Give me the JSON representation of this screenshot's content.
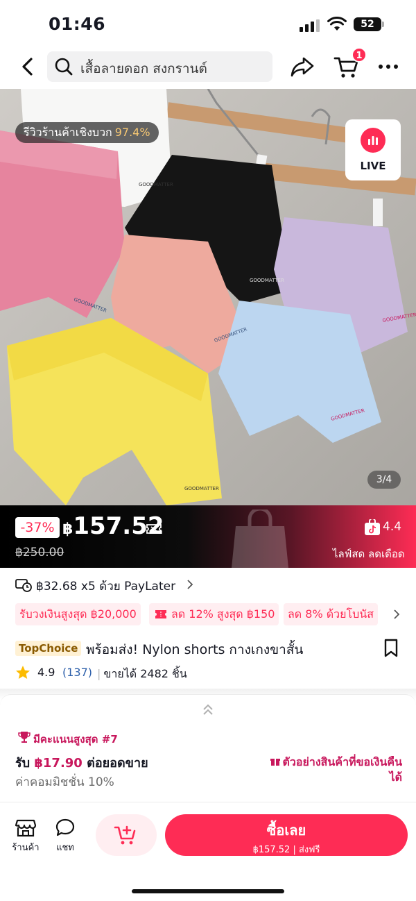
{
  "status_bar": {
    "time": "01:46",
    "battery": "52"
  },
  "search": {
    "query": "เสื้อลายดอก สงกรานต์"
  },
  "cart": {
    "badge": "1"
  },
  "gallery": {
    "review_label": "รีวิวร้านค้าเชิงบวก",
    "review_pct": "97.4%",
    "live_label": "LIVE",
    "page_indicator": "3/4",
    "garment_brand": "GOODMATTER"
  },
  "price": {
    "discount": "-37%",
    "currency": "฿",
    "current": "157.52",
    "original": "฿250.00",
    "tt_rating": "4.4",
    "live_sale": "ไลฟ์สด ลดเดือด"
  },
  "paylater": {
    "text": "฿32.68 x5 ด้วย PayLater"
  },
  "promos": [
    "รับวงเงินสูงสุด ฿20,000",
    "ลด 12% สูงสุด ฿150",
    "ลด 8% ด้วยโบนัส"
  ],
  "product": {
    "badge": "TopChoice",
    "title": "พร้อมส่ง! Nylon shorts กางเกงขาสั้น",
    "rating": "4.9",
    "reviews": "(137)",
    "sold": "ขายได้ 2482 ชิ้น"
  },
  "affiliate": {
    "rank": "มีคะแนนสูงสุด #7",
    "earn_prefix": "รับ",
    "earn_amount": "฿17.90",
    "earn_suffix": "ต่อยอดขาย",
    "commission": "ค่าคอมมิชชั่น 10%",
    "refund_link": "ตัวอย่างสินค้าที่ขอเงินคืนได้"
  },
  "bottom_bar": {
    "shop_label": "ร้านค้า",
    "chat_label": "แชท",
    "buy_label": "ซื้อเลย",
    "buy_sub": "฿157.52 | ส่งฟรี"
  },
  "colors": {
    "accent": "#fe2c55",
    "affiliate": "#c8175c"
  }
}
